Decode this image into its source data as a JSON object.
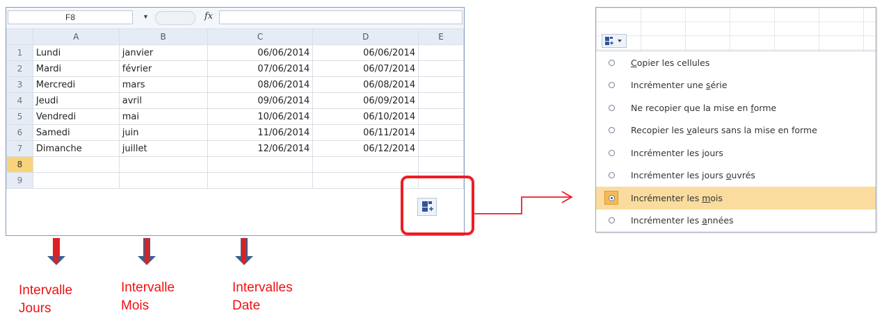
{
  "sheet": {
    "name_box": "F8",
    "fx_label": "fx",
    "columns": [
      "A",
      "B",
      "C",
      "D",
      "E"
    ],
    "rows": [
      {
        "num": "1",
        "cells": [
          "Lundi",
          "janvier",
          "06/06/2014",
          "06/06/2014",
          ""
        ]
      },
      {
        "num": "2",
        "cells": [
          "Mardi",
          "février",
          "07/06/2014",
          "06/07/2014",
          ""
        ]
      },
      {
        "num": "3",
        "cells": [
          "Mercredi",
          "mars",
          "08/06/2014",
          "06/08/2014",
          ""
        ]
      },
      {
        "num": "4",
        "cells": [
          "Jeudi",
          "avril",
          "09/06/2014",
          "06/09/2014",
          ""
        ]
      },
      {
        "num": "5",
        "cells": [
          "Vendredi",
          "mai",
          "10/06/2014",
          "06/10/2014",
          ""
        ]
      },
      {
        "num": "6",
        "cells": [
          "Samedi",
          "juin",
          "11/06/2014",
          "06/11/2014",
          ""
        ]
      },
      {
        "num": "7",
        "cells": [
          "Dimanche",
          "juillet",
          "12/06/2014",
          "06/12/2014",
          ""
        ]
      },
      {
        "num": "8",
        "cells": [
          "",
          "",
          "",
          "",
          ""
        ]
      },
      {
        "num": "9",
        "cells": [
          "",
          "",
          "",
          "",
          ""
        ]
      }
    ],
    "selected_row": "8",
    "autofill_icon": "auto-fill-options-icon"
  },
  "captions": {
    "jours": [
      "Intervalle",
      "Jours"
    ],
    "mois": [
      "Intervalle",
      "Mois"
    ],
    "date": [
      "Intervalles",
      "Date"
    ]
  },
  "menu": {
    "items": [
      {
        "pre": "",
        "ul": "C",
        "post": "opier les cellules",
        "selected": false
      },
      {
        "pre": "Incrémenter une ",
        "ul": "s",
        "post": "érie",
        "selected": false
      },
      {
        "pre": "Ne recopier que la mise en ",
        "ul": "f",
        "post": "orme",
        "selected": false
      },
      {
        "pre": "Recopier les ",
        "ul": "v",
        "post": "aleurs sans la mise en forme",
        "selected": false
      },
      {
        "pre": "Incrémenter les ",
        "ul": "j",
        "post": "ours",
        "selected": false
      },
      {
        "pre": "Incrémenter les jours ",
        "ul": "o",
        "post": "uvrés",
        "selected": false
      },
      {
        "pre": "Incrémenter les ",
        "ul": "m",
        "post": "ois",
        "selected": true
      },
      {
        "pre": "Incrémenter les ",
        "ul": "a",
        "post": "nnées",
        "selected": false
      }
    ]
  },
  "colors": {
    "highlight": "#ee1d24",
    "arrow_shaft": "#e02020",
    "arrow_head": "#3b5f8f",
    "caption": "#ee1111",
    "menu_selected": "#f9dc9e"
  }
}
